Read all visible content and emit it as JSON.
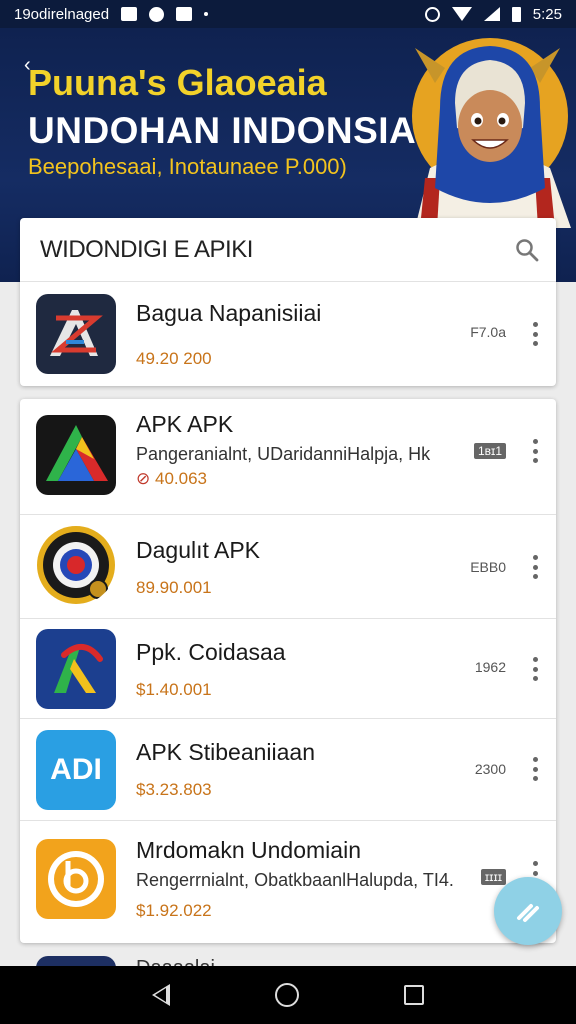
{
  "status_bar": {
    "left_text": "19odirelnaged",
    "right_text": "5:25"
  },
  "banner": {
    "title_line1": "Puuna's Glaoeaia",
    "title_line2": "UNDOHAN INDONSIA",
    "subtitle": "Beepohesaai, Inotaunaee P.000)"
  },
  "search": {
    "label": "WIDONDIGI E APIKI",
    "icon": "search-icon"
  },
  "featured_app": {
    "name": "Bagua Napanisiiai",
    "price": "49.20 200",
    "size": "F7.0a",
    "icon": "az-app-icon"
  },
  "apps": [
    {
      "name": "APK APK",
      "desc": "Pangeranialnt, UDaridanniHalpja, Hk",
      "price": "40.063",
      "size": "1ʙɪ1",
      "size_boxed": true,
      "has_warning": true,
      "icon": "triangle-app-icon"
    },
    {
      "name": "Dagulıt APK",
      "desc": "",
      "price": "89.90.001",
      "size": "EBB0",
      "size_boxed": false,
      "has_warning": false,
      "icon": "target-app-icon"
    },
    {
      "name": "Ppk. Coidasaa",
      "desc": "",
      "price": "$1.40.001",
      "size": "1962",
      "size_boxed": false,
      "has_warning": false,
      "icon": "arc-app-icon"
    },
    {
      "name": "APK Stibeaniiaan",
      "desc": "",
      "price": "$3.23.803",
      "size": "2300",
      "size_boxed": false,
      "has_warning": false,
      "icon": "adi-app-icon"
    },
    {
      "name": "Mrdomakn Undomiain",
      "desc": "Rengerrnialnt, ObatkbaanlHalupda, TI4.",
      "price": "$1.92.022",
      "size": "ɪɪɪɪ",
      "size_boxed": true,
      "has_warning": false,
      "icon": "b-coin-app-icon"
    }
  ],
  "adi_icon_text": "ADI",
  "peek_text": "Daaaalai",
  "colors": {
    "banner_bg": "#152c63",
    "title_yellow": "#f2d22a",
    "price_orange": "#c8741a",
    "fab": "#8fd1e6"
  }
}
